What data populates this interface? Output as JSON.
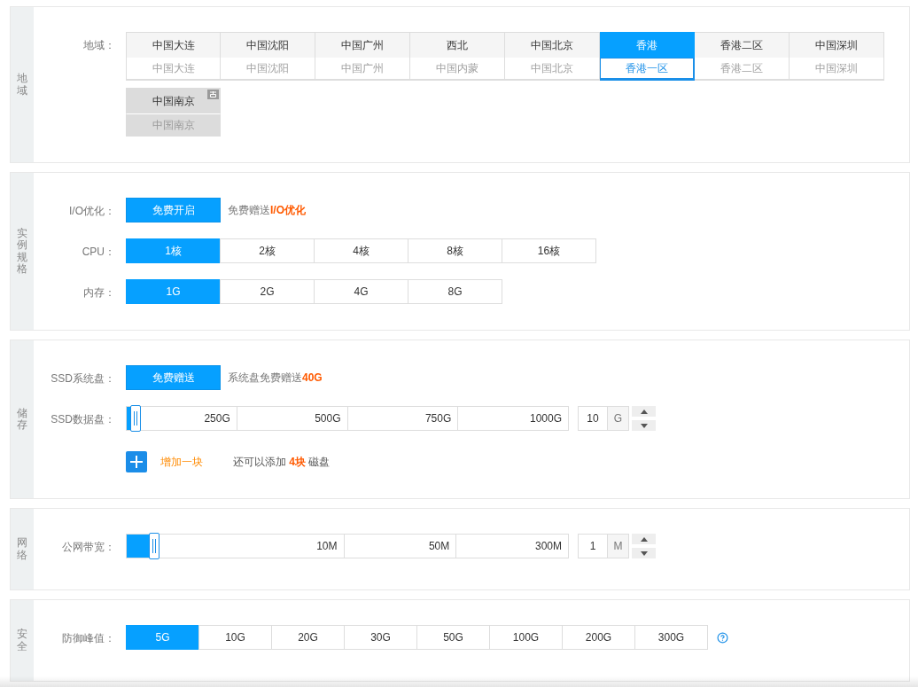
{
  "sections": [
    {
      "side_label": "地域",
      "rows": [
        {
          "kind": "regions",
          "label": "地域：",
          "items": [
            {
              "name": "中国大连",
              "zone": "中国大连",
              "selected": false,
              "disabled": false,
              "badge": false
            },
            {
              "name": "中国沈阳",
              "zone": "中国沈阳",
              "selected": false,
              "disabled": false,
              "badge": false
            },
            {
              "name": "中国广州",
              "zone": "中国广州",
              "selected": false,
              "disabled": false,
              "badge": false
            },
            {
              "name": "西北",
              "zone": "中国内蒙",
              "selected": false,
              "disabled": false,
              "badge": false
            },
            {
              "name": "中国北京",
              "zone": "中国北京",
              "selected": false,
              "disabled": false,
              "badge": false
            },
            {
              "name": "香港",
              "zone": "香港一区",
              "selected": true,
              "disabled": false,
              "badge": false
            },
            {
              "name": "香港二区",
              "zone": "香港二区",
              "selected": false,
              "disabled": false,
              "badge": false
            },
            {
              "name": "中国深圳",
              "zone": "中国深圳",
              "selected": false,
              "disabled": false,
              "badge": false
            },
            {
              "name": "中国南京",
              "zone": "中国南京",
              "selected": false,
              "disabled": true,
              "badge": true
            }
          ]
        }
      ]
    },
    {
      "side_label": "实例规格",
      "rows": [
        {
          "kind": "button",
          "label": "I/O优化：",
          "button": "免费开启",
          "note": "免费赠送**I/O优化**"
        },
        {
          "kind": "options",
          "label": "CPU：",
          "options": [
            {
              "text": "1核",
              "selected": true
            },
            {
              "text": "2核",
              "selected": false
            },
            {
              "text": "4核",
              "selected": false
            },
            {
              "text": "8核",
              "selected": false
            },
            {
              "text": "16核",
              "selected": false
            }
          ]
        },
        {
          "kind": "options",
          "label": "内存：",
          "options": [
            {
              "text": "1G",
              "selected": true
            },
            {
              "text": "2G",
              "selected": false
            },
            {
              "text": "4G",
              "selected": false
            },
            {
              "text": "8G",
              "selected": false
            }
          ]
        }
      ]
    },
    {
      "side_label": "储存",
      "rows": [
        {
          "kind": "button",
          "label": "SSD系统盘：",
          "button": "免费赠送",
          "note": "系统盘免费赠送**40G**"
        },
        {
          "kind": "slider",
          "label": "SSD数据盘：",
          "level": 0.02,
          "marks": [
            "250G",
            "500G",
            "750G",
            "1000G"
          ],
          "value": "10",
          "unit": "G"
        },
        {
          "kind": "add",
          "link": "增加一块",
          "note": "还可以添加 **4块** 磁盘"
        }
      ]
    },
    {
      "side_label": "网络",
      "rows": [
        {
          "kind": "slider",
          "label": "公网带宽：",
          "level": 0.062,
          "marks": [
            "10M",
            "50M",
            "300M"
          ],
          "value": "1",
          "unit": "M"
        }
      ]
    },
    {
      "side_label": "安全",
      "rows": [
        {
          "kind": "options",
          "label": "防御峰值：",
          "help": true,
          "options": [
            {
              "text": "5G",
              "selected": true
            },
            {
              "text": "10G",
              "selected": false
            },
            {
              "text": "20G",
              "selected": false
            },
            {
              "text": "30G",
              "selected": false
            },
            {
              "text": "50G",
              "selected": false
            },
            {
              "text": "100G",
              "selected": false
            },
            {
              "text": "200G",
              "selected": false
            },
            {
              "text": "300G",
              "selected": false
            }
          ]
        }
      ]
    }
  ]
}
